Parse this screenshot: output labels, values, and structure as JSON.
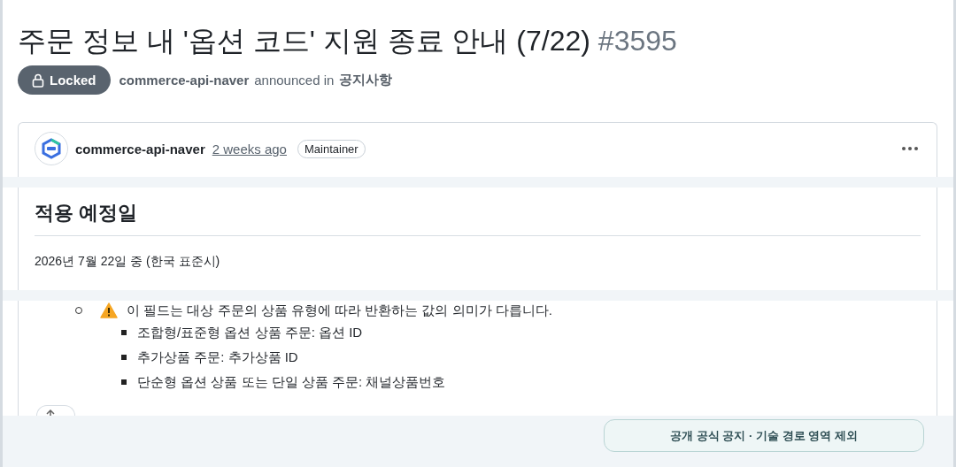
{
  "discussion": {
    "title": "주문 정보 내 '옵션 코드' 지원 종료 안내 (7/22)",
    "number": "#3595",
    "locked_label": "Locked",
    "author": "commerce-api-naver",
    "announced_text": "announced in",
    "category": "공지사항"
  },
  "post": {
    "author": "commerce-api-naver",
    "time": "2 weeks ago",
    "role_badge": "Maintainer"
  },
  "section": {
    "heading": "적용 예정일",
    "date_text": "2026년 7월 22일 중 (한국 표준시)"
  },
  "note": {
    "text": "이 필드는 대상 주문의 상품 유형에 따라 반환하는 값의 의미가 다릅니다.",
    "sub_items": [
      "조합형/표준형 옵션 상품 주문: 옵션 ID",
      "추가상품 주문: 추가상품 ID",
      "단순형 옵션 상품 또는 단일 상품 주문: 채널상품번호"
    ]
  },
  "footer_button": "공개 공식 공지 · 기술 경로 영역 제외"
}
